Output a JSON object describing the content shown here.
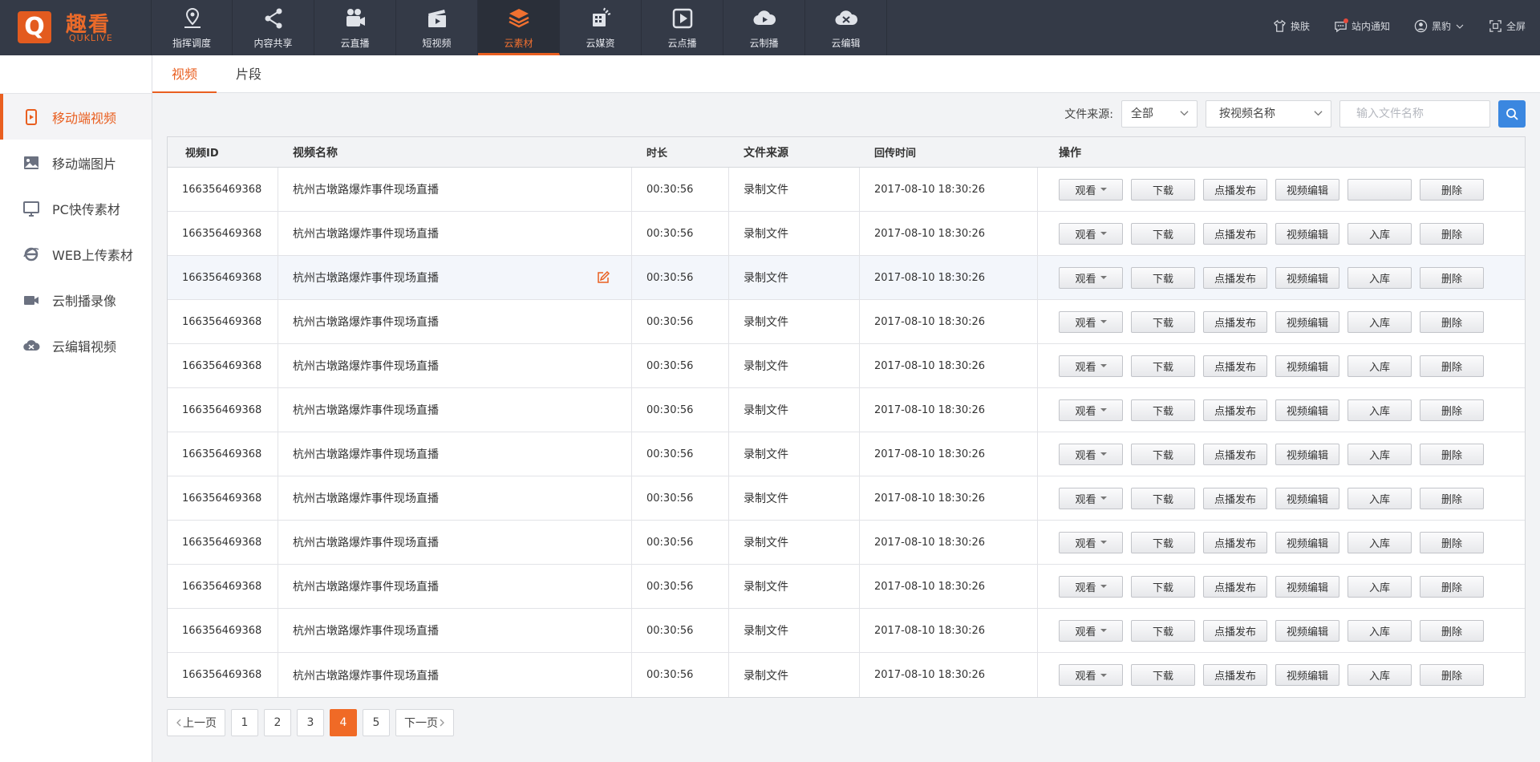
{
  "brand": {
    "logo_letter": "Q",
    "name_cn": "趣看",
    "name_en": "QUKLIVE",
    "accent": "#e95f20"
  },
  "nav": [
    {
      "label": "指挥调度",
      "icon": "location-pin-icon"
    },
    {
      "label": "内容共享",
      "icon": "share-icon"
    },
    {
      "label": "云直播",
      "icon": "video-camera-icon"
    },
    {
      "label": "短视频",
      "icon": "clapperboard-icon"
    },
    {
      "label": "云素材",
      "icon": "layers-icon",
      "active": true
    },
    {
      "label": "云媒资",
      "icon": "media-grid-icon"
    },
    {
      "label": "云点播",
      "icon": "play-square-icon"
    },
    {
      "label": "云制播",
      "icon": "cloud-play-icon"
    },
    {
      "label": "云编辑",
      "icon": "cloud-scissors-icon"
    }
  ],
  "topright": {
    "skin": "换肤",
    "notify": "站内通知",
    "user": "黑豹",
    "fullscreen": "全屏"
  },
  "sidebar": [
    {
      "label": "移动端视频",
      "icon": "mobile-video-icon",
      "active": true
    },
    {
      "label": "移动端图片",
      "icon": "image-icon"
    },
    {
      "label": "PC快传素材",
      "icon": "monitor-icon"
    },
    {
      "label": "WEB上传素材",
      "icon": "browser-e-icon"
    },
    {
      "label": "云制播录像",
      "icon": "camera-record-icon"
    },
    {
      "label": "云编辑视频",
      "icon": "cloud-edit-icon"
    }
  ],
  "subtabs": [
    {
      "label": "视频",
      "active": true
    },
    {
      "label": "片段"
    }
  ],
  "filters": {
    "source_label": "文件来源:",
    "source_value": "全部",
    "field_value": "按视频名称",
    "search_placeholder": "输入文件名称"
  },
  "table": {
    "headers": {
      "id": "视频ID",
      "name": "视频名称",
      "duration": "时长",
      "source": "文件来源",
      "time": "回传时间",
      "actions": "操作"
    },
    "action_labels": {
      "watch": "观看",
      "download": "下载",
      "vod": "点播发布",
      "edit": "视频编辑",
      "store": "入库",
      "delete": "删除"
    },
    "rows": [
      {
        "id": "166356469368",
        "name": "杭州古墩路爆炸事件现场直播",
        "duration": "00:30:56",
        "source": "录制文件",
        "time": "2017-08-10  18:30:26",
        "store_label": ""
      },
      {
        "id": "166356469368",
        "name": "杭州古墩路爆炸事件现场直播",
        "duration": "00:30:56",
        "source": "录制文件",
        "time": "2017-08-10  18:30:26",
        "store_label": "入库"
      },
      {
        "id": "166356469368",
        "name": "杭州古墩路爆炸事件现场直播",
        "duration": "00:30:56",
        "source": "录制文件",
        "time": "2017-08-10  18:30:26",
        "store_label": "入库",
        "highlight": true
      },
      {
        "id": "166356469368",
        "name": "杭州古墩路爆炸事件现场直播",
        "duration": "00:30:56",
        "source": "录制文件",
        "time": "2017-08-10  18:30:26",
        "store_label": "入库"
      },
      {
        "id": "166356469368",
        "name": "杭州古墩路爆炸事件现场直播",
        "duration": "00:30:56",
        "source": "录制文件",
        "time": "2017-08-10  18:30:26",
        "store_label": "入库"
      },
      {
        "id": "166356469368",
        "name": "杭州古墩路爆炸事件现场直播",
        "duration": "00:30:56",
        "source": "录制文件",
        "time": "2017-08-10  18:30:26",
        "store_label": "入库"
      },
      {
        "id": "166356469368",
        "name": "杭州古墩路爆炸事件现场直播",
        "duration": "00:30:56",
        "source": "录制文件",
        "time": "2017-08-10  18:30:26",
        "store_label": "入库"
      },
      {
        "id": "166356469368",
        "name": "杭州古墩路爆炸事件现场直播",
        "duration": "00:30:56",
        "source": "录制文件",
        "time": "2017-08-10  18:30:26",
        "store_label": "入库"
      },
      {
        "id": "166356469368",
        "name": "杭州古墩路爆炸事件现场直播",
        "duration": "00:30:56",
        "source": "录制文件",
        "time": "2017-08-10  18:30:26",
        "store_label": "入库"
      },
      {
        "id": "166356469368",
        "name": "杭州古墩路爆炸事件现场直播",
        "duration": "00:30:56",
        "source": "录制文件",
        "time": "2017-08-10  18:30:26",
        "store_label": "入库"
      },
      {
        "id": "166356469368",
        "name": "杭州古墩路爆炸事件现场直播",
        "duration": "00:30:56",
        "source": "录制文件",
        "time": "2017-08-10  18:30:26",
        "store_label": "入库"
      },
      {
        "id": "166356469368",
        "name": "杭州古墩路爆炸事件现场直播",
        "duration": "00:30:56",
        "source": "录制文件",
        "time": "2017-08-10  18:30:26",
        "store_label": "入库"
      }
    ]
  },
  "pagination": {
    "prev": "上一页",
    "next": "下一页",
    "pages": [
      "1",
      "2",
      "3",
      "4",
      "5"
    ],
    "current": "4"
  }
}
